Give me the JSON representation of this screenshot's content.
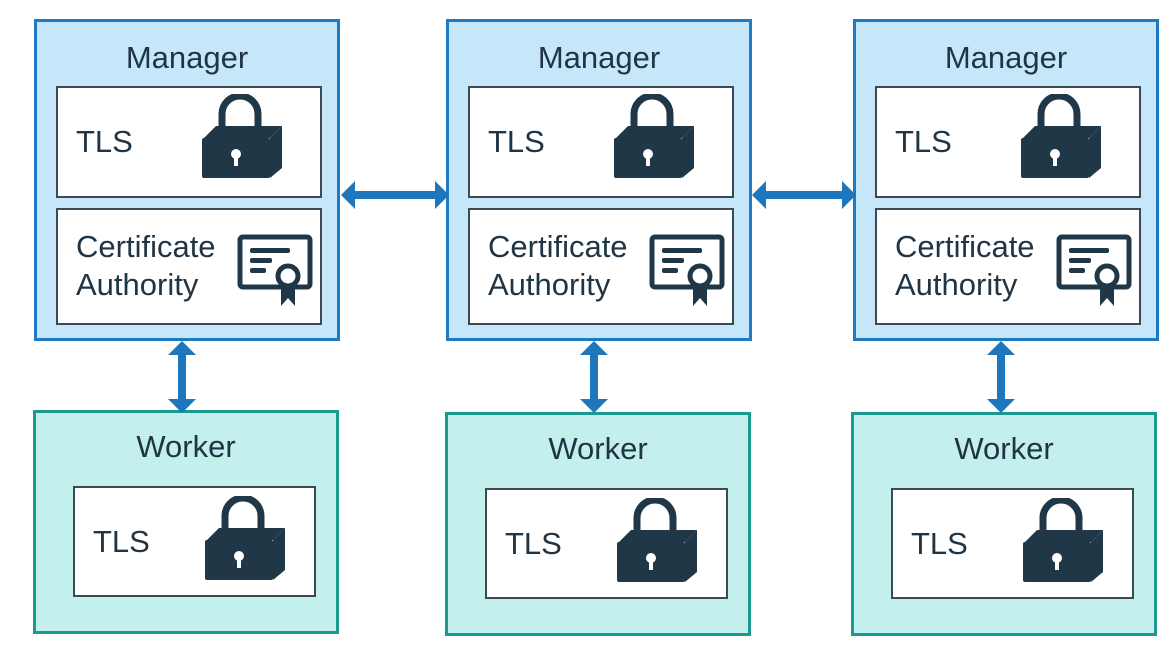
{
  "colors": {
    "manager_fill": "#c6e7f9",
    "manager_border": "#1e7bc3",
    "worker_fill": "#c3efec",
    "worker_border": "#1a9a91",
    "arrow": "#1e76bd",
    "icon": "#203747"
  },
  "columns": [
    {
      "manager": {
        "title": "Manager",
        "tls": "TLS",
        "ca": "Certificate Authority"
      },
      "worker": {
        "title": "Worker",
        "tls": "TLS"
      }
    },
    {
      "manager": {
        "title": "Manager",
        "tls": "TLS",
        "ca": "Certificate Authority"
      },
      "worker": {
        "title": "Worker",
        "tls": "TLS"
      }
    },
    {
      "manager": {
        "title": "Manager",
        "tls": "TLS",
        "ca": "Certificate Authority"
      },
      "worker": {
        "title": "Worker",
        "tls": "TLS"
      }
    }
  ],
  "icons": {
    "tls": "padlock-icon",
    "ca": "certificate-icon"
  }
}
